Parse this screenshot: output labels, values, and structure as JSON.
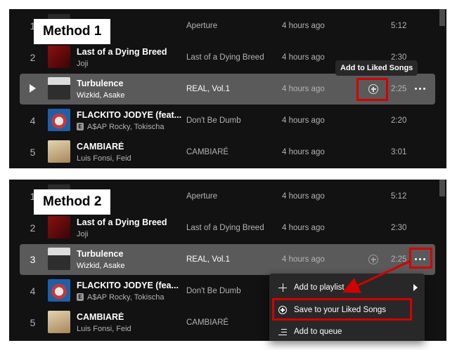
{
  "method1": {
    "label": "Method 1",
    "tooltip": "Add to Liked Songs",
    "tracks": [
      {
        "num": "1",
        "title": "",
        "artist": "",
        "album": "Aperture",
        "added": "4 hours ago",
        "duration": "5:12",
        "explicit": false,
        "art": "#2a2a2a"
      },
      {
        "num": "2",
        "title": "Last of a Dying Breed",
        "artist": "Joji",
        "album": "Last of a Dying Breed",
        "added": "4 hours ago",
        "duration": "2:30",
        "explicit": false,
        "art": "#6b0d0d"
      },
      {
        "num": "3",
        "title": "Turbulence",
        "artist": "Wizkid, Asake",
        "album": "REAL, Vol.1",
        "added": "4 hours ago",
        "duration": "2:25",
        "explicit": false,
        "art": "#3a3a3a"
      },
      {
        "num": "4",
        "title": "FLACKITO JODYE (feat...",
        "artist": "A$AP Rocky, Tokischa",
        "album": "Don't Be Dumb",
        "added": "4 hours ago",
        "duration": "2:20",
        "explicit": true,
        "art": "#c23a3a"
      },
      {
        "num": "5",
        "title": "CAMBIARÉ",
        "artist": "Luis Fonsi, Feid",
        "album": "CAMBIARÉ",
        "added": "4 hours ago",
        "duration": "3:01",
        "explicit": false,
        "art": "#c9b48a"
      }
    ]
  },
  "method2": {
    "label": "Method 2",
    "tracks": [
      {
        "num": "1",
        "title": "",
        "artist": "",
        "album": "Aperture",
        "added": "4 hours ago",
        "duration": "5:12",
        "explicit": false,
        "art": "#2a2a2a"
      },
      {
        "num": "2",
        "title": "Last of a Dying Breed",
        "artist": "Joji",
        "album": "Last of a Dying Breed",
        "added": "4 hours ago",
        "duration": "2:30",
        "explicit": false,
        "art": "#6b0d0d"
      },
      {
        "num": "3",
        "title": "Turbulence",
        "artist": "Wizkid, Asake",
        "album": "REAL, Vol.1",
        "added": "4 hours ago",
        "duration": "2:25",
        "explicit": false,
        "art": "#3a3a3a"
      },
      {
        "num": "4",
        "title": "FLACKITO JODYE (fea...",
        "artist": "A$AP Rocky, Tokischa",
        "album": "Don't Be Dumb",
        "added": "",
        "duration": "",
        "explicit": true,
        "art": "#c23a3a"
      },
      {
        "num": "5",
        "title": "CAMBIARÉ",
        "artist": "Luis Fonsi, Feid",
        "album": "CAMBIARÉ",
        "added": "",
        "duration": "",
        "explicit": false,
        "art": "#c9b48a"
      }
    ],
    "menu": {
      "add_to_playlist": "Add to playlist",
      "save_liked": "Save to your Liked Songs",
      "add_to_queue": "Add to queue"
    }
  },
  "explicit_badge": "E",
  "colors": {
    "highlight": "#d40000",
    "panel": "#121212",
    "selected_row": "#5a5a5a"
  }
}
